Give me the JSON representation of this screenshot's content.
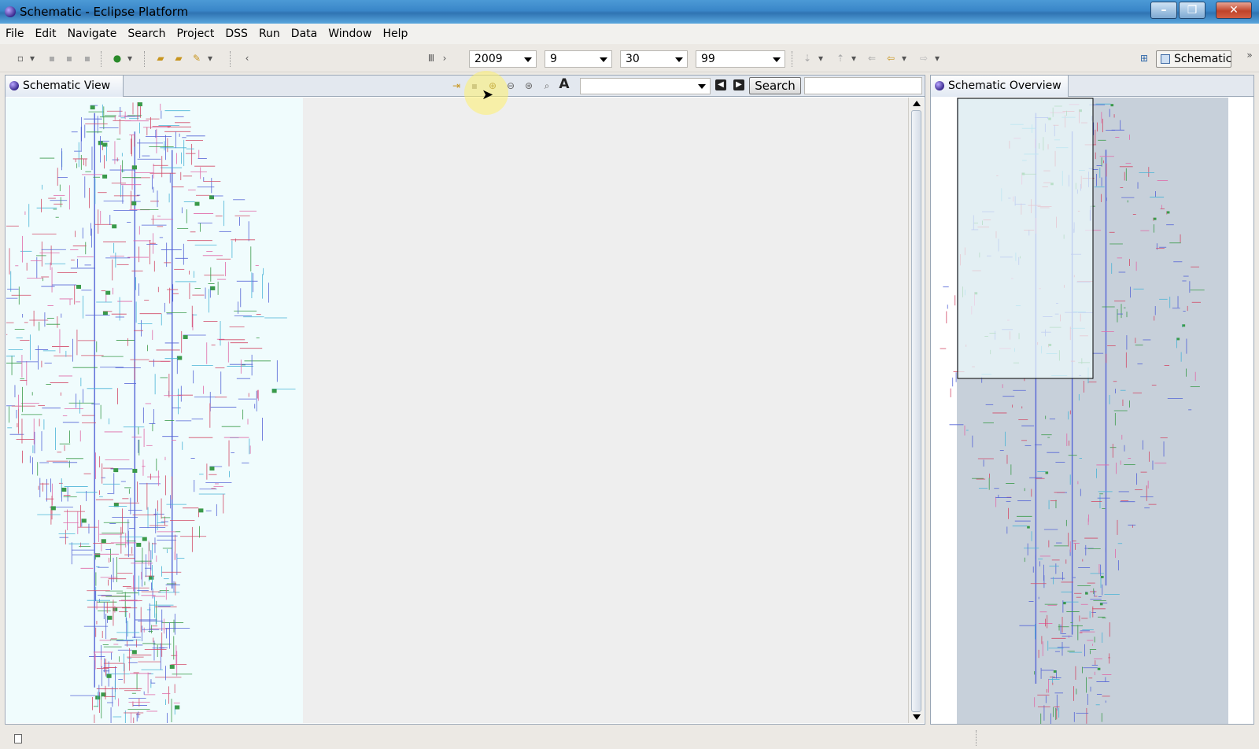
{
  "window": {
    "title": "Schematic - Eclipse Platform"
  },
  "menu": [
    "File",
    "Edit",
    "Navigate",
    "Search",
    "Project",
    "DSS",
    "Run",
    "Data",
    "Window",
    "Help"
  ],
  "toolbar": {
    "year": "2009",
    "month": "9",
    "day": "30",
    "hour": "99",
    "perspective_label": "Schematic"
  },
  "schematic_view": {
    "tab_label": "Schematic View",
    "search_label": "Search",
    "search_value": ""
  },
  "overview": {
    "tab_label": "Schematic Overview"
  },
  "colors": {
    "schematic_bg": "#f0fcfd",
    "overview_bg": "#c7d0da",
    "line_blue": "#5565d6",
    "line_red": "#d24b68",
    "line_green": "#3a9a4a",
    "line_pink": "#e06aa8",
    "line_cyan": "#49b3d6"
  }
}
